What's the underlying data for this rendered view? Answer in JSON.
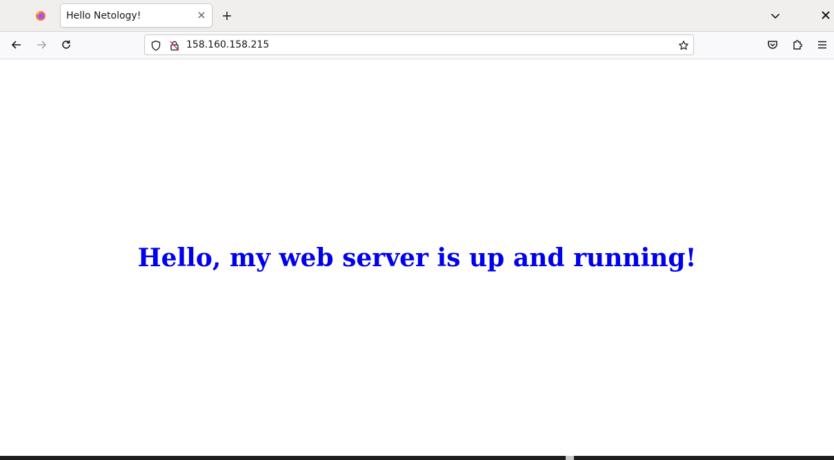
{
  "browser": {
    "tab": {
      "title": "Hello Netology!"
    },
    "address_bar": {
      "url": "158.160.158.215"
    },
    "icons": {
      "firefox": "firefox-logo-icon",
      "tab_close": "close-icon",
      "new_tab": "plus-icon",
      "tab_list": "chevron-down-icon",
      "window_close": "close-icon",
      "back": "arrow-left-icon",
      "forward": "arrow-right-icon",
      "reload": "reload-icon",
      "tracking": "shield-icon",
      "connection": "insecure-lock-icon",
      "bookmark": "star-icon",
      "pocket": "pocket-icon",
      "extensions": "puzzle-icon",
      "menu": "hamburger-menu-icon"
    }
  },
  "page": {
    "heading": "Hello, my web server is up and running!",
    "heading_color": "#0000ee"
  }
}
